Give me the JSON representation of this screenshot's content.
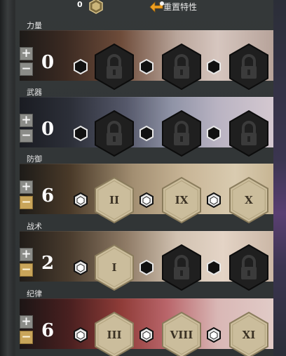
{
  "header": {
    "points_available": "0",
    "points_icon": "hex-token-icon",
    "reset_label": "重置特性",
    "reset_icon": "orange-arrow-icon"
  },
  "lines": [
    {
      "title": "力量",
      "points": "0",
      "minus_active": false,
      "majors": [
        {
          "state": "locked",
          "label": ""
        },
        {
          "state": "locked",
          "label": ""
        },
        {
          "state": "locked",
          "label": ""
        }
      ],
      "minors_lit": [
        false,
        false,
        false
      ]
    },
    {
      "title": "武器",
      "points": "0",
      "minus_active": false,
      "majors": [
        {
          "state": "locked",
          "label": ""
        },
        {
          "state": "locked",
          "label": ""
        },
        {
          "state": "locked",
          "label": ""
        }
      ],
      "minors_lit": [
        false,
        false,
        false
      ]
    },
    {
      "title": "防御",
      "points": "6",
      "minus_active": true,
      "majors": [
        {
          "state": "unlocked",
          "label": "II"
        },
        {
          "state": "unlocked",
          "label": "IX"
        },
        {
          "state": "unlocked",
          "label": "X"
        }
      ],
      "minors_lit": [
        true,
        true,
        true
      ]
    },
    {
      "title": "战术",
      "points": "2",
      "minus_active": true,
      "majors": [
        {
          "state": "unlocked",
          "label": "I"
        },
        {
          "state": "locked",
          "label": ""
        },
        {
          "state": "locked",
          "label": ""
        }
      ],
      "minors_lit": [
        true,
        false,
        false
      ]
    },
    {
      "title": "纪律",
      "points": "6",
      "minus_active": true,
      "majors": [
        {
          "state": "unlocked",
          "label": "III"
        },
        {
          "state": "unlocked",
          "label": "VIII"
        },
        {
          "state": "unlocked",
          "label": "XI"
        }
      ],
      "minors_lit": [
        true,
        true,
        true
      ]
    }
  ],
  "buttons": {
    "plus_symbol": "+",
    "minus_symbol": "−"
  },
  "colors": {
    "minus_active": "#c9a55a",
    "button_inactive": "#8b8c88",
    "hex_unlocked": "#cbbd9c",
    "hex_locked": "#1f1f1f",
    "reset_arrow": "#f0a020"
  }
}
